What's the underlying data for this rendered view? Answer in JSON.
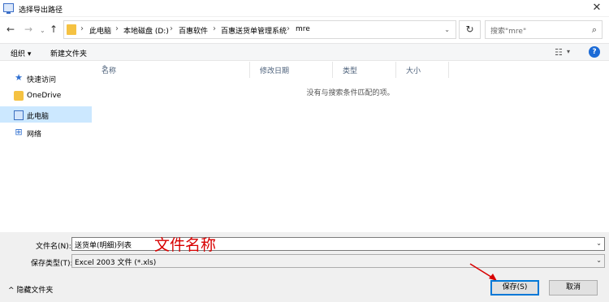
{
  "window": {
    "title": "选择导出路径",
    "close_glyph": "✕"
  },
  "nav": {
    "back": "←",
    "forward": "→",
    "recent": "⌄",
    "up": "↑",
    "breadcrumbs": [
      "此电脑",
      "本地磁盘 (D:)",
      "百惠软件",
      "百惠送货单管理系统",
      "mre"
    ],
    "breadcrumb_sep": "›",
    "refresh": "↻",
    "search_placeholder": "搜索\"mre\""
  },
  "toolbar": {
    "organize_label": "组织 ▾",
    "new_folder_label": "新建文件夹",
    "help": "?"
  },
  "sidebar": {
    "items": [
      {
        "label": "快速访问",
        "icon": "star-icon",
        "selected": false
      },
      {
        "label": "OneDrive",
        "icon": "onedrive-icon",
        "selected": false
      },
      {
        "label": "此电脑",
        "icon": "computer-icon",
        "selected": true
      },
      {
        "label": "网络",
        "icon": "network-icon",
        "selected": false
      }
    ]
  },
  "filelist": {
    "columns": [
      "名称",
      "修改日期",
      "类型",
      "大小"
    ],
    "empty_message": "没有与搜索条件匹配的项。"
  },
  "form": {
    "filename_label": "文件名(N):",
    "filename_value": "送货单(明细)列表",
    "filetype_label": "保存类型(T):",
    "filetype_value": "Excel 2003 文件 (*.xls)",
    "annotation": "文件名称",
    "hide_folders_label": "^ 隐藏文件夹",
    "save_label": "保存(S)",
    "cancel_label": "取消"
  },
  "colors": {
    "accent": "#0078d7",
    "selected_bg": "#cce8ff",
    "annotation": "#d80000"
  }
}
